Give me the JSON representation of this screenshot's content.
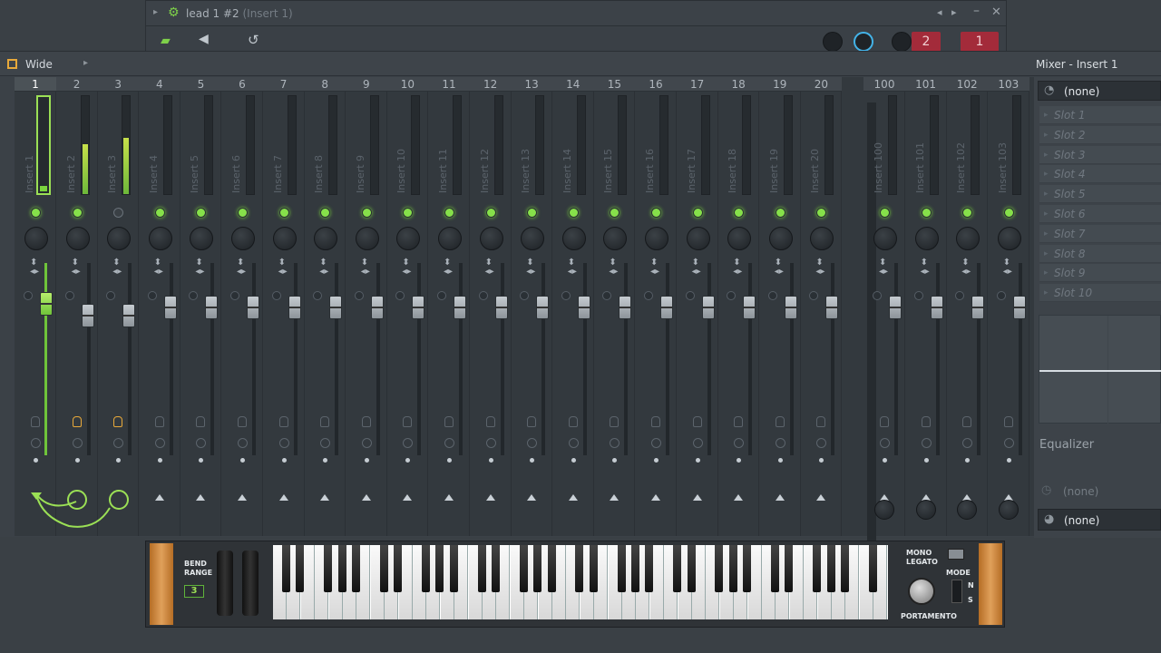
{
  "channel_window": {
    "title": "lead 1 #2",
    "subtitle": "(Insert 1)",
    "badge_2": "2",
    "badge_1": "1"
  },
  "mixer": {
    "preset_label": "Wide",
    "title": "Mixer - Insert 1",
    "strips": [
      {
        "num": "1",
        "name": "Insert 1"
      },
      {
        "num": "2",
        "name": "Insert 2"
      },
      {
        "num": "3",
        "name": "Insert 3"
      },
      {
        "num": "4",
        "name": "Insert 4"
      },
      {
        "num": "5",
        "name": "Insert 5"
      },
      {
        "num": "6",
        "name": "Insert 6"
      },
      {
        "num": "7",
        "name": "Insert 7"
      },
      {
        "num": "8",
        "name": "Insert 8"
      },
      {
        "num": "9",
        "name": "Insert 9"
      },
      {
        "num": "10",
        "name": "Insert 10"
      },
      {
        "num": "11",
        "name": "Insert 11"
      },
      {
        "num": "12",
        "name": "Insert 12"
      },
      {
        "num": "13",
        "name": "Insert 13"
      },
      {
        "num": "14",
        "name": "Insert 14"
      },
      {
        "num": "15",
        "name": "Insert 15"
      },
      {
        "num": "16",
        "name": "Insert 16"
      },
      {
        "num": "17",
        "name": "Insert 17"
      },
      {
        "num": "18",
        "name": "Insert 18"
      },
      {
        "num": "19",
        "name": "Insert 19"
      },
      {
        "num": "20",
        "name": "Insert 20"
      }
    ],
    "strips_right": [
      {
        "num": "100",
        "name": "Insert 100"
      },
      {
        "num": "101",
        "name": "Insert 101"
      },
      {
        "num": "102",
        "name": "Insert 102"
      },
      {
        "num": "103",
        "name": "Insert 103"
      }
    ]
  },
  "panel": {
    "input_value": "(none)",
    "slots": [
      "Slot 1",
      "Slot 2",
      "Slot 3",
      "Slot 4",
      "Slot 5",
      "Slot 6",
      "Slot 7",
      "Slot 8",
      "Slot 9",
      "Slot 10"
    ],
    "eq_label": "Equalizer",
    "send_value": "(none)",
    "output_value": "(none)"
  },
  "piano": {
    "bend_label": "BEND",
    "range_label": "RANGE",
    "range_value": "3",
    "mono_label": "MONO",
    "legato_label": "LEGATO",
    "mode_label": "MODE",
    "portamento_label": "PORTAMENTO",
    "n_label": "N",
    "s_label": "S"
  },
  "colors": {
    "accent_green": "#86e04a",
    "badge_red": "#a32b3a"
  }
}
